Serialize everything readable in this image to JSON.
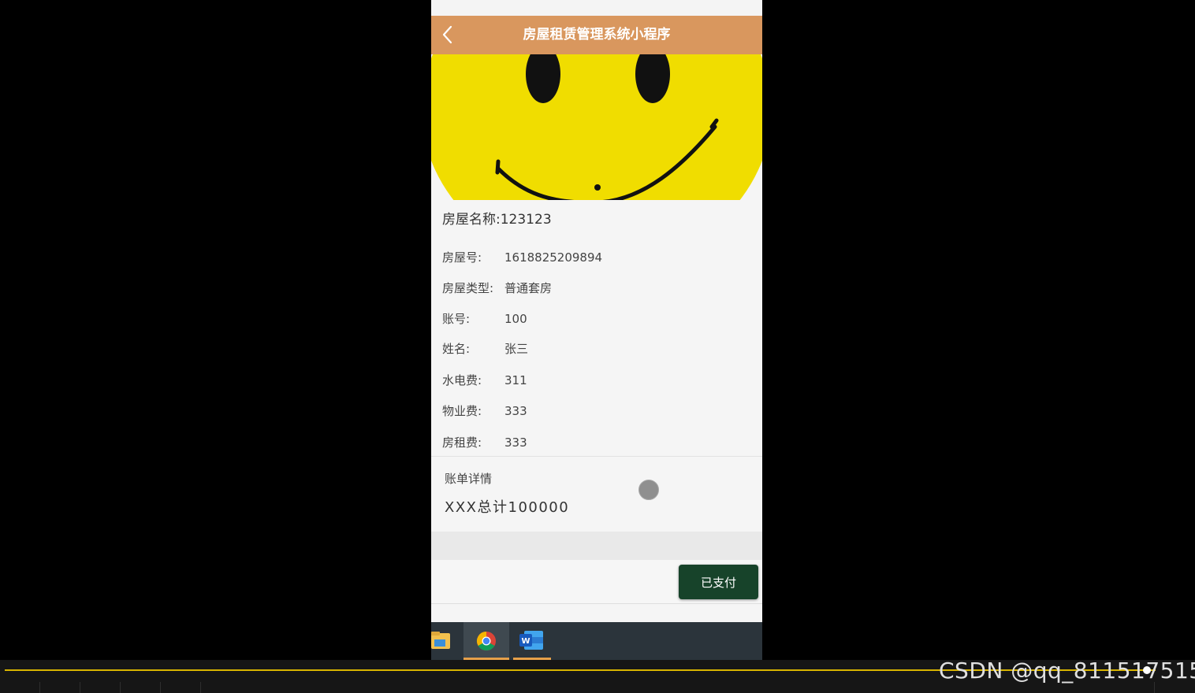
{
  "app": {
    "title": "房屋租赁管理系统小程序",
    "accent_color": "#d9975e",
    "back_icon": "chevron-left-icon"
  },
  "house": {
    "name_label": "房屋名称:",
    "name_value": "123123",
    "fields": [
      {
        "key": "房屋号:",
        "value": "1618825209894"
      },
      {
        "key": "房屋类型:",
        "value": "普通套房"
      },
      {
        "key": "账号:",
        "value": "100"
      },
      {
        "key": "姓名:",
        "value": "张三"
      },
      {
        "key": "水电费:",
        "value": "311"
      },
      {
        "key": "物业费:",
        "value": "333"
      },
      {
        "key": "房租费:",
        "value": "333"
      }
    ]
  },
  "bill": {
    "title": "账单详情",
    "content": "XXX总计100000"
  },
  "actions": {
    "paid_label": "已支付",
    "paid_color": "#17432a"
  },
  "taskbar": {
    "apps": [
      "file-explorer-icon",
      "chrome-icon",
      "word-icon"
    ],
    "underline_color": "#e6a04a"
  },
  "watermark": "CSDN @qq_811517515"
}
